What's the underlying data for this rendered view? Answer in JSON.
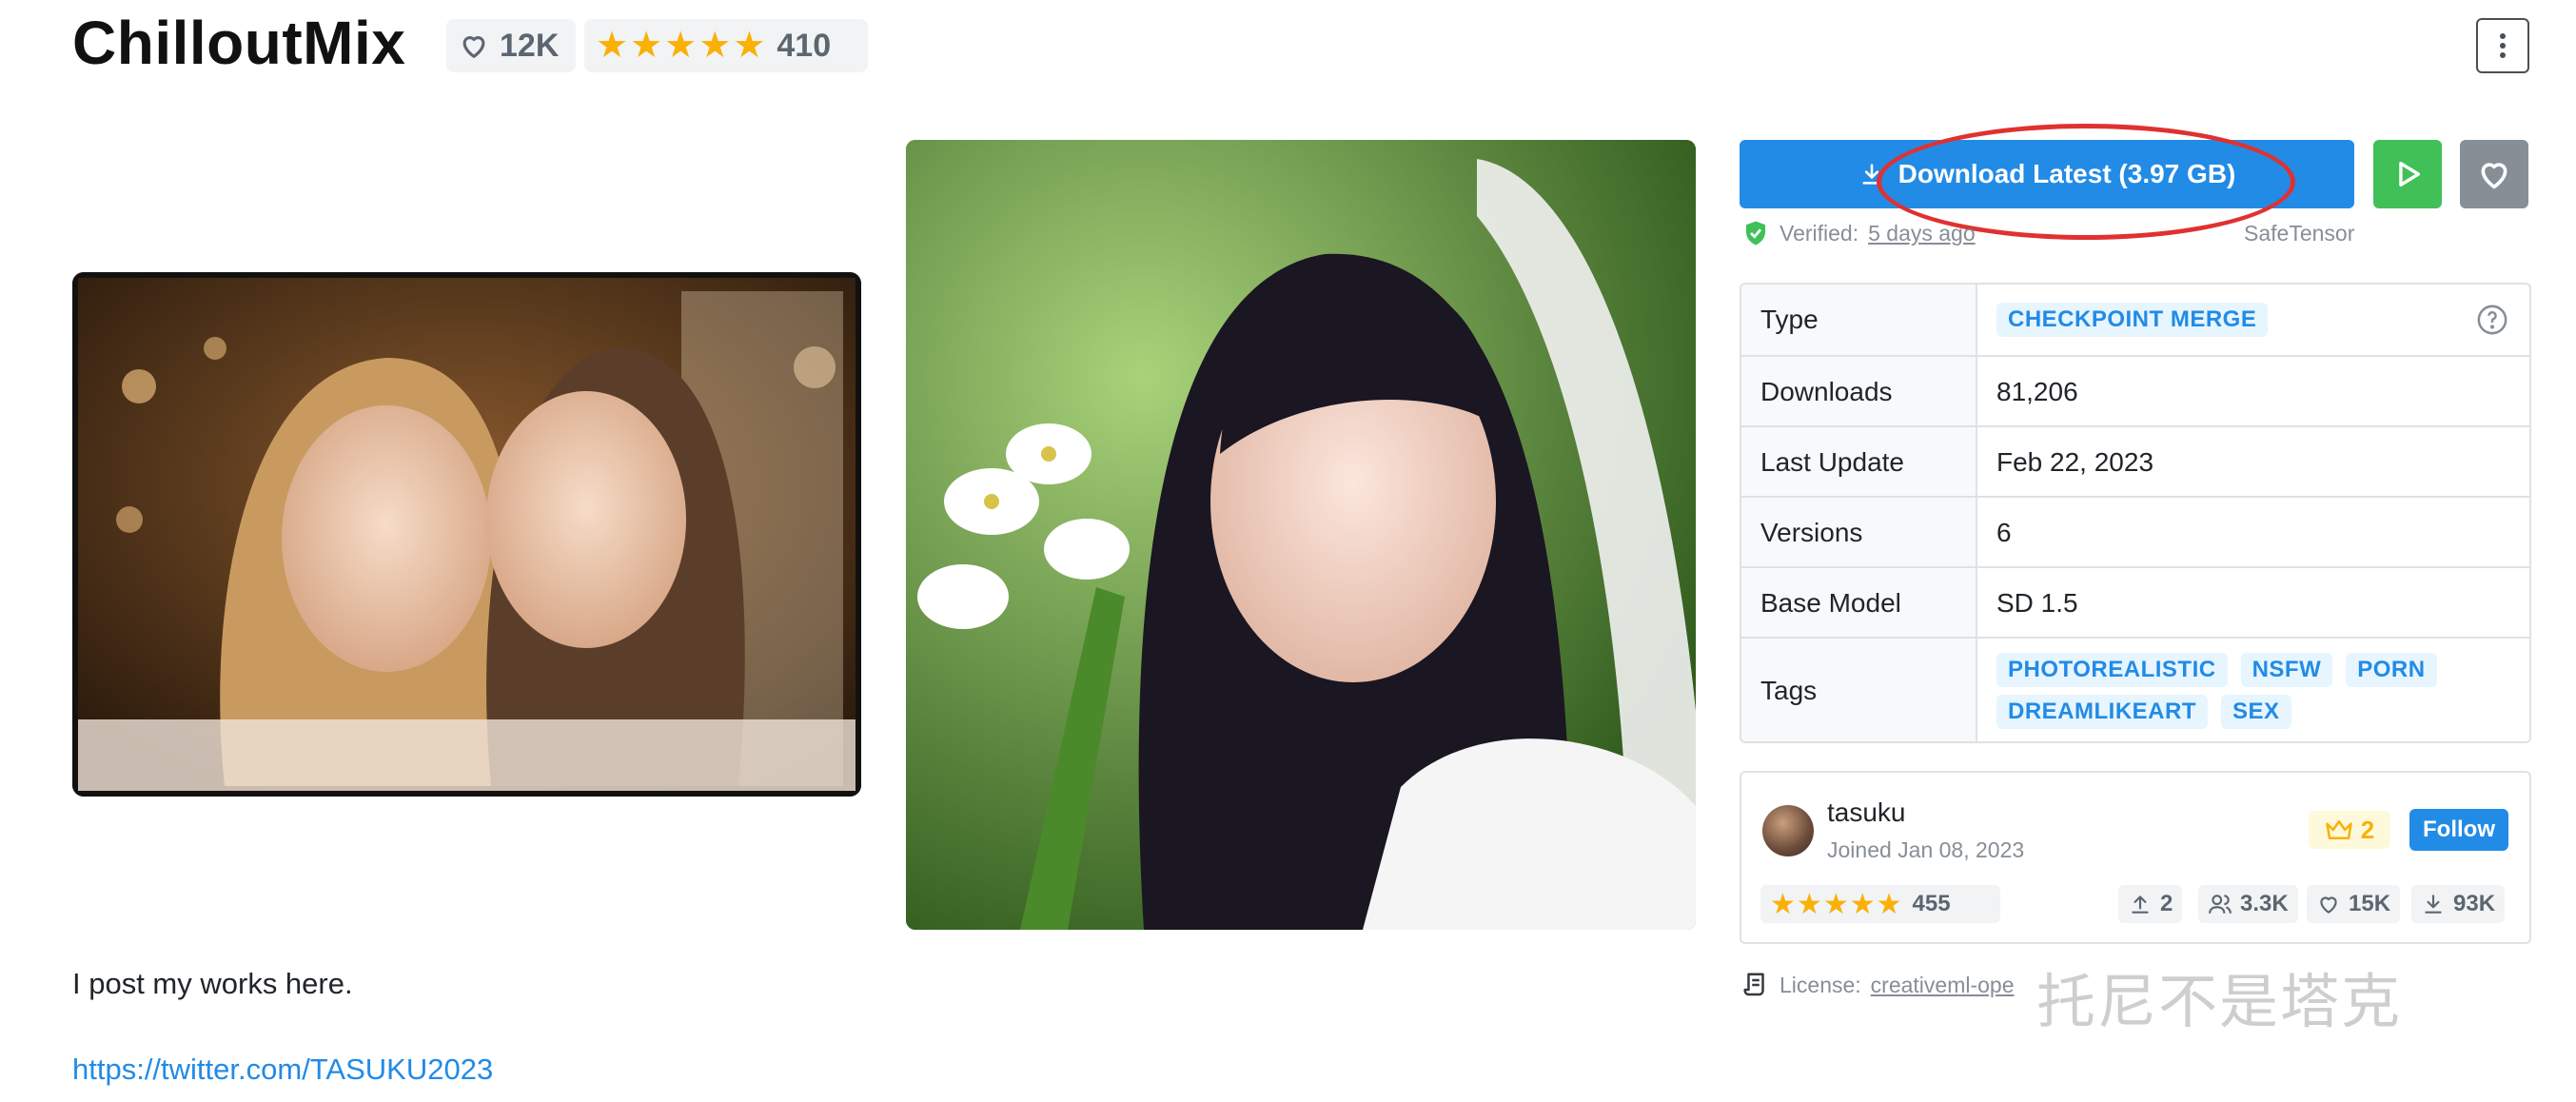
{
  "model": {
    "title": "ChilloutMix",
    "likes": "12K",
    "rating_count": "410"
  },
  "download": {
    "label": "Download Latest (3.97 GB)",
    "verified_label": "Verified:",
    "verified_when": "5 days ago",
    "format": "SafeTensor"
  },
  "details": {
    "rows": [
      {
        "label": "Type",
        "value": "CHECKPOINT MERGE"
      },
      {
        "label": "Downloads",
        "value": "81,206"
      },
      {
        "label": "Last Update",
        "value": "Feb 22, 2023"
      },
      {
        "label": "Versions",
        "value": "6"
      },
      {
        "label": "Base Model",
        "value": "SD 1.5"
      },
      {
        "label": "Tags",
        "value": ""
      }
    ],
    "tags": [
      "PHOTOREALISTIC",
      "NSFW",
      "PORN",
      "DREAMLIKEART",
      "SEX"
    ]
  },
  "creator": {
    "name": "tasuku",
    "joined": "Joined Jan 08, 2023",
    "rank": "2",
    "follow_label": "Follow",
    "rating_count": "455",
    "uploads": "2",
    "followers": "3.3K",
    "likes": "15K",
    "downloads": "93K"
  },
  "license": {
    "label": "License:",
    "value": "creativeml-ope"
  },
  "watermark": "托尼不是塔克",
  "description": {
    "text": "I post my works here.",
    "link": "https://twitter.com/TASUKU2023"
  },
  "colors": {
    "primary": "#228be6",
    "success": "#40c057",
    "gray": "#868e96",
    "star": "#fab005",
    "annotation": "#e03131"
  }
}
